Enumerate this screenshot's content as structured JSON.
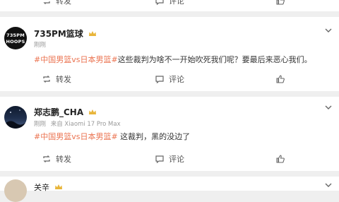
{
  "posts": [
    {
      "actions": {
        "repost": "转发",
        "comment": "评论",
        "like": ""
      }
    },
    {
      "user": {
        "name": "735PM篮球",
        "avatar_text": [
          "735PM",
          "HOOPS"
        ]
      },
      "meta": {
        "time": "刚刚",
        "source": ""
      },
      "content": {
        "hashtag": "#中国男篮vs日本男篮#",
        "text": "这些裁判为啥不一开始吹死我们呢？要最后来恶心我们。"
      },
      "actions": {
        "repost": "转发",
        "comment": "评论",
        "like": ""
      }
    },
    {
      "user": {
        "name": "郑志鹏_CHA"
      },
      "meta": {
        "time": "刚刚",
        "source": "来自 Xiaomi 17 Pro Max"
      },
      "content": {
        "hashtag": "#中国男篮vs日本男篮#",
        "text": " 这裁判，黑的没边了"
      },
      "actions": {
        "repost": "转发",
        "comment": "评论",
        "like": ""
      }
    },
    {
      "user": {
        "name": "关辛"
      }
    }
  ],
  "colors": {
    "hashtag": "#eb7350",
    "crown": "#e8b53a",
    "background": "#efefef"
  },
  "icons": {
    "repost": "repost-icon",
    "comment": "comment-icon",
    "like": "thumbs-up-icon",
    "badge": "crown-badge-icon",
    "menu": "chevron-down-icon"
  }
}
